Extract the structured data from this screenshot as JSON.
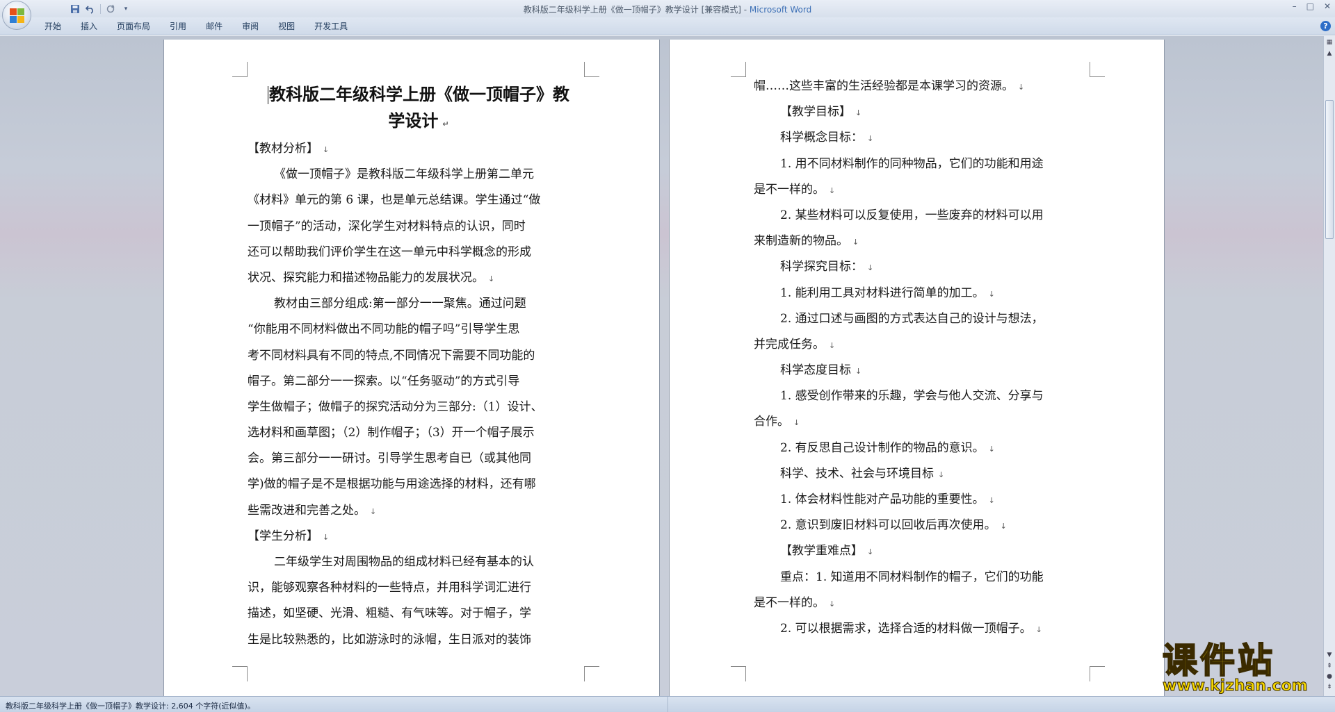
{
  "window": {
    "title_doc": "教科版二年级科学上册《做一顶帽子》教学设计 [兼容模式] - ",
    "title_app": "Microsoft Word"
  },
  "qat": {
    "save_icon": "save-icon",
    "undo_icon": "undo-icon",
    "redo_icon": "redo-icon",
    "customize_icon": "dropdown-icon"
  },
  "ribbon": {
    "tabs": [
      "开始",
      "插入",
      "页面布局",
      "引用",
      "邮件",
      "审阅",
      "视图",
      "开发工具"
    ]
  },
  "document": {
    "title_line1": "教科版二年级科学上册《做一顶帽子》教",
    "title_line2": "学设计",
    "left_lines": [
      "【教材分析】",
      "《做一顶帽子》是教科版二年级科学上册第二单元",
      "《材料》单元的第 6 课，也是单元总结课。学生通过“做",
      "一顶帽子”的活动，深化学生对材料特点的认识，同时",
      "还可以帮助我们评价学生在这一单元中科学概念的形成",
      "状况、探究能力和描述物品能力的发展状况。",
      "教材由三部分组成:第一部分一一聚焦。通过问题",
      "“你能用不同材料做出不同功能的帽子吗”引导学生思",
      "考不同材料具有不同的特点,不同情况下需要不同功能的",
      "帽子。第二部分一一探索。以“任务驱动”的方式引导",
      "学生做帽子；做帽子的探究活动分为三部分:（1）设计、",
      "选材料和画草图；（2）制作帽子；（3）开一个帽子展示",
      "会。第三部分一一研讨。引导学生思考自已（或其他同",
      "学)做的帽子是不是根据功能与用途选择的材料，还有哪",
      "些需改进和完善之处。",
      "【学生分析】",
      "二年级学生对周围物品的组成材料已经有基本的认",
      "识，能够观察各种材料的一些特点，并用科学词汇进行",
      "描述，如坚硬、光滑、粗糙、有气味等。对于帽子，学",
      "生是比较熟悉的，比如游泳时的泳帽，生日派对的装饰"
    ],
    "right_lines": [
      "帽……这些丰富的生活经验都是本课学习的资源。",
      "【教学目标】",
      "科学概念目标：",
      "1. 用不同材料制作的同种物品，它们的功能和用途",
      "是不一样的。",
      "2. 某些材料可以反复使用，一些废弃的材料可以用",
      "来制造新的物品。",
      "科学探究目标：",
      "1. 能利用工具对材料进行简单的加工。",
      "2. 通过口述与画图的方式表达自己的设计与想法，",
      "并完成任务。",
      "科学态度目标",
      "1. 感受创作带来的乐趣，学会与他人交流、分享与",
      "合作。",
      "2. 有反思自己设计制作的物品的意识。",
      "科学、技术、社会与环境目标",
      "1. 体会材料性能对产品功能的重要性。",
      "2. 意识到废旧材料可以回收后再次使用。",
      "【教学重难点】",
      "重点：1. 知道用不同材料制作的帽子，它们的功能",
      "是不一样的。",
      "2. 可以根据需求，选择合适的材料做一顶帽子。"
    ]
  },
  "status": {
    "text": "教科版二年级科学上册《做一顶帽子》教学设计: 2,604 个字符(近似值)。"
  },
  "watermark": {
    "cn": "课件站",
    "url": "www.kjzhan.com"
  }
}
